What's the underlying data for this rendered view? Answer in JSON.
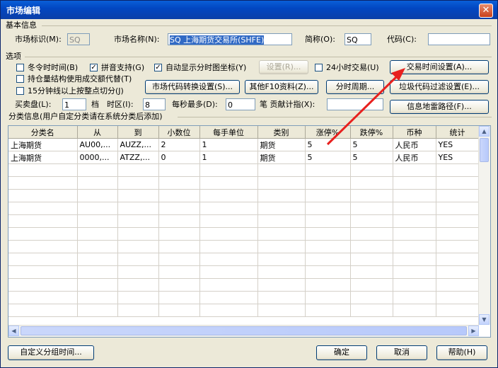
{
  "window": {
    "title": "市场编辑",
    "close_glyph": "✕"
  },
  "basic": {
    "group_label": "基本信息",
    "market_id_label": "市场标识(M):",
    "market_id_value": "SQ",
    "market_name_label": "市场名称(N):",
    "market_name_value": "SQ 上海期货交易所(SHFE)",
    "abbr_label": "简称(O):",
    "abbr_value": "SQ",
    "code_label": "代码(C):",
    "code_value": ""
  },
  "options": {
    "group_label": "选项",
    "dst_label": "冬令时时间(B)",
    "dst_checked": false,
    "pinyin_label": "拼音支持(G)",
    "pinyin_checked": true,
    "autocoord_label": "自动显示分时图坐标(Y)",
    "autocoord_checked": true,
    "setup_btn": "设置(R)...",
    "h24_label": "24小时交易(U)",
    "h24_checked": false,
    "trade_time_btn": "交易时间设置(A)...",
    "holding_label": "持仓量结构使用成交额代替(T)",
    "holding_checked": false,
    "min15_label": "15分钟线以上按整点切分(J)",
    "min15_checked": false,
    "code_convert_btn": "市场代码转换设置(S)...",
    "f10_btn": "其他F10资料(Z)...",
    "period_btn": "分时周期...",
    "junk_filter_btn": "垃圾代码过滤设置(E)...",
    "bidask_label": "买卖盘(L):",
    "bidask_value": "1",
    "level_label": "档",
    "tz_label": "时区(I):",
    "tz_value": "8",
    "persec_label": "每秒最多(D):",
    "persec_value": "0",
    "contrib_label": "笔 贡献计指(X):",
    "contrib_value": "",
    "minepath_btn": "信息地雷路径(F)..."
  },
  "category": {
    "group_label": "分类信息(用户自定分类请在系统分类后添加)",
    "columns": [
      "分类名",
      "从",
      "到",
      "小数位",
      "每手单位",
      "类别",
      "涨停%",
      "跌停%",
      "币种",
      "统计"
    ],
    "rows": [
      [
        "上海期货",
        "AU00,...",
        "AUZZ,...",
        "2",
        "1",
        "期货",
        "5",
        "5",
        "人民币",
        "YES"
      ],
      [
        "上海期货",
        "0000,...",
        "ATZZ,...",
        "0",
        "1",
        "期货",
        "5",
        "5",
        "人民币",
        "YES"
      ]
    ]
  },
  "footer": {
    "custom_group_btn": "自定义分组时间...",
    "ok_btn": "确定",
    "cancel_btn": "取消",
    "help_btn": "帮助(H)"
  },
  "colors": {
    "annotation_arrow": "#e8201e",
    "selection": "#316ac5",
    "title_bar": "#0247c2"
  }
}
